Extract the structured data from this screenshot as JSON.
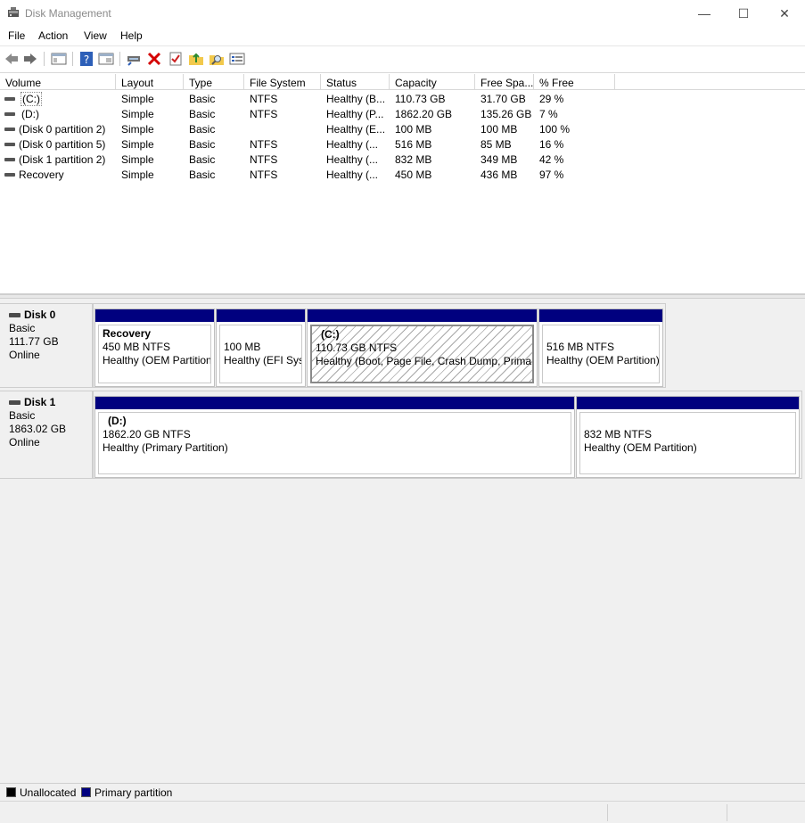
{
  "window": {
    "title": "Disk Management",
    "minimize": "—",
    "maximize": "☐",
    "close": "✕"
  },
  "menu": [
    "File",
    "Action",
    "View",
    "Help"
  ],
  "toolbar": {
    "icons": [
      "back-icon",
      "forward-icon",
      "console-tree-icon",
      "help-icon",
      "properties-icon",
      "connect-icon",
      "delete-icon",
      "check-icon",
      "open-folder-icon",
      "search-folder-icon",
      "list-icon"
    ]
  },
  "volume_table": {
    "columns": [
      "Volume",
      "Layout",
      "Type",
      "File System",
      "Status",
      "Capacity",
      "Free Spa...",
      "% Free"
    ],
    "rows": [
      [
        "(C:)",
        "Simple",
        "Basic",
        "NTFS",
        "Healthy (B...",
        "110.73 GB",
        "31.70 GB",
        "29 %"
      ],
      [
        "(D:)",
        "Simple",
        "Basic",
        "NTFS",
        "Healthy (P...",
        "1862.20 GB",
        "135.26 GB",
        "7 %"
      ],
      [
        "(Disk 0 partition 2)",
        "Simple",
        "Basic",
        "",
        "Healthy (E...",
        "100 MB",
        "100 MB",
        "100 %"
      ],
      [
        "(Disk 0 partition 5)",
        "Simple",
        "Basic",
        "NTFS",
        "Healthy (...",
        "516 MB",
        "85 MB",
        "16 %"
      ],
      [
        "(Disk 1 partition 2)",
        "Simple",
        "Basic",
        "NTFS",
        "Healthy (...",
        "832 MB",
        "349 MB",
        "42 %"
      ],
      [
        "Recovery",
        "Simple",
        "Basic",
        "NTFS",
        "Healthy (...",
        "450 MB",
        "436 MB",
        "97 %"
      ]
    ]
  },
  "disks": [
    {
      "name": "Disk 0",
      "type": "Basic",
      "size": "111.77 GB",
      "status": "Online",
      "partitions": [
        {
          "name": "Recovery",
          "size": "450 MB NTFS",
          "status": "Healthy (OEM Partition)",
          "hatched": false
        },
        {
          "name": "",
          "size": "100 MB",
          "status": "Healthy (EFI System Partition)",
          "hatched": false
        },
        {
          "name": "(C:)",
          "size": "110.73 GB NTFS",
          "status": "Healthy (Boot, Page File, Crash Dump, Primary Partition)",
          "hatched": true
        },
        {
          "name": "",
          "size": "516 MB NTFS",
          "status": "Healthy (OEM Partition)",
          "hatched": false
        }
      ]
    },
    {
      "name": "Disk 1",
      "type": "Basic",
      "size": "1863.02 GB",
      "status": "Online",
      "partitions": [
        {
          "name": "(D:)",
          "size": "1862.20 GB NTFS",
          "status": "Healthy (Primary Partition)",
          "hatched": false
        },
        {
          "name": "",
          "size": "832 MB NTFS",
          "status": "Healthy (OEM Partition)",
          "hatched": false
        }
      ]
    }
  ],
  "legend": [
    {
      "label": "Unallocated",
      "color": "#000000"
    },
    {
      "label": "Primary partition",
      "color": "#00007f"
    }
  ]
}
